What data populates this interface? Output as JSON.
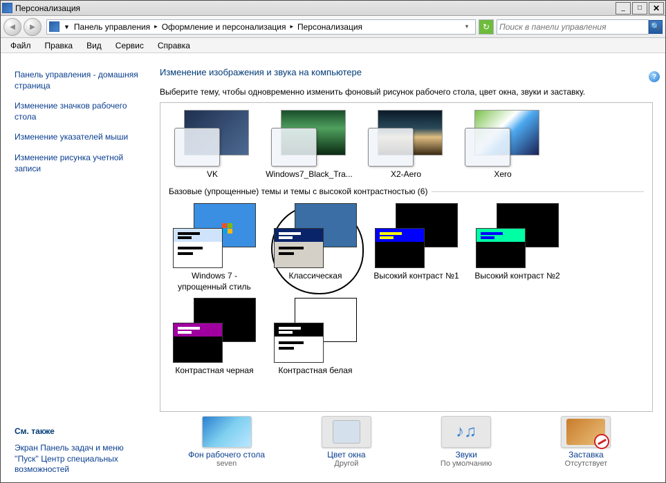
{
  "window": {
    "title": "Персонализация"
  },
  "breadcrumb": {
    "items": [
      "Панель управления",
      "Оформление и персонализация",
      "Персонализация"
    ]
  },
  "search": {
    "placeholder": "Поиск в панели управления"
  },
  "menu": {
    "items": [
      "Файл",
      "Правка",
      "Вид",
      "Сервис",
      "Справка"
    ]
  },
  "sidebar": {
    "links": [
      "Панель управления - домашняя страница",
      "Изменение значков рабочего стола",
      "Изменение указателей мыши",
      "Изменение рисунка учетной записи"
    ],
    "see_also_title": "См. также",
    "see_also_links": [
      "Экран",
      "Панель задач и меню ''Пуск''",
      "Центр специальных возможностей"
    ]
  },
  "main": {
    "heading": "Изменение изображения и звука на компьютере",
    "desc": "Выберите тему, чтобы одновременно изменить фоновый рисунок рабочего стола, цвет окна, звуки и заставку.",
    "themes_top": [
      {
        "label": "VK",
        "bg": "linear-gradient(135deg,#1e3050,#4d6a92)"
      },
      {
        "label": "Windows7_Black_Tra...",
        "bg": "linear-gradient(#1a4e2b,#4fa05e 40%,#0a2a12)"
      },
      {
        "label": "X2-Aero",
        "bg": "linear-gradient(#0a1a2a,#2a4a5a 40%,#e0be82 60%,#3a2a14)"
      },
      {
        "label": "Xero",
        "bg": "linear-gradient(135deg,#79c14a,#ffffff 40%,#4daaf0 55%,#1a2254)"
      }
    ],
    "group_basic": "Базовые (упрощенные) темы и темы с высокой контрастностью (6)",
    "themes_basic": [
      {
        "label": "Windows 7 - упрощенный стиль",
        "back": "#3b8fe3",
        "backlogo": true,
        "tb": "#cfe4fb",
        "row1": "#000",
        "row2": "#000",
        "front": "#fff"
      },
      {
        "label": "Классическая",
        "back": "#3a6ea5",
        "backlogo": false,
        "tb": "#0a246a",
        "row1": "#fff",
        "row2": "#fff",
        "front": "#d4d0c8"
      },
      {
        "label": "Высокий контраст №1",
        "back": "#000",
        "backlogo": false,
        "tb": "#0000ff",
        "row1": "#ffff00",
        "row2": "#ffff00",
        "front": "#000"
      },
      {
        "label": "Высокий контраст №2",
        "back": "#000",
        "backlogo": false,
        "tb": "#00ffa5",
        "row1": "#0000ff",
        "row2": "#0000ff",
        "front": "#000"
      },
      {
        "label": "Контрастная черная",
        "back": "#000",
        "backlogo": false,
        "tb": "#a000a0",
        "row1": "#fff",
        "row2": "#fff",
        "front": "#000"
      },
      {
        "label": "Контрастная белая",
        "back": "#fff",
        "border": "#000",
        "backlogo": false,
        "tb": "#000",
        "row1": "#fff",
        "row2": "#fff",
        "front": "#fff"
      }
    ]
  },
  "footer": {
    "items": [
      {
        "label": "Фон рабочего стола",
        "sub": "seven",
        "icon": "wallpaper"
      },
      {
        "label": "Цвет окна",
        "sub": "Другой",
        "icon": "window-color"
      },
      {
        "label": "Звуки",
        "sub": "По умолчанию",
        "icon": "sounds"
      },
      {
        "label": "Заставка",
        "sub": "Отсутствует",
        "icon": "screensaver"
      }
    ]
  }
}
